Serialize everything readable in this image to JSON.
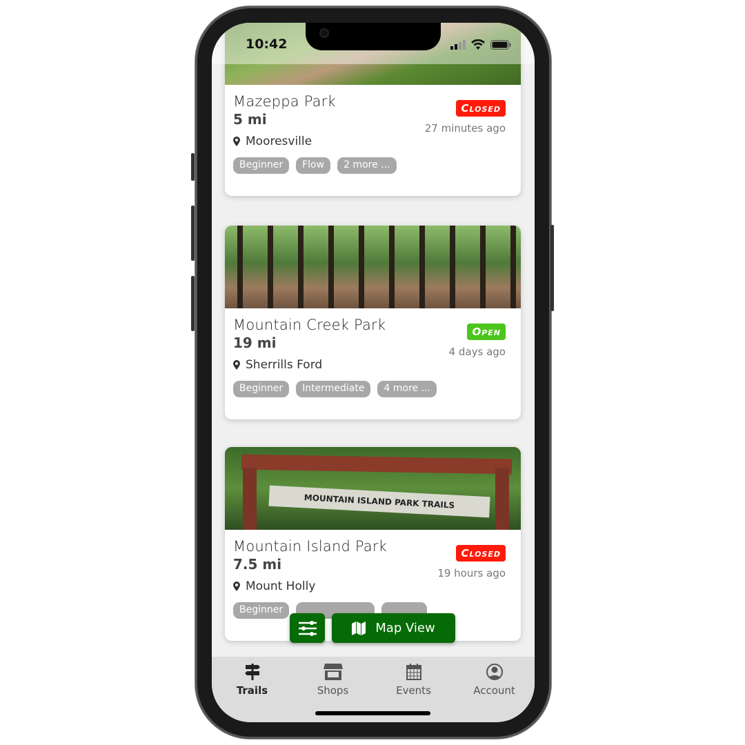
{
  "status_bar": {
    "time": "10:42"
  },
  "colors": {
    "closed": "#ff1a0a",
    "open": "#4cc51c",
    "primary": "#066b06",
    "tag": "#a8a8a8"
  },
  "trails": [
    {
      "name": "Mazeppa Park",
      "distance": "5 mi",
      "location": "Mooresville",
      "status": "Closed",
      "updated": "27 minutes ago",
      "tags": [
        "Beginner",
        "Flow",
        "2 more ..."
      ]
    },
    {
      "name": "Mountain Creek Park",
      "distance": "19 mi",
      "location": "Sherrills Ford",
      "status": "Open",
      "updated": "4 days ago",
      "tags": [
        "Beginner",
        "Intermediate",
        "4 more ..."
      ]
    },
    {
      "name": "Mountain Island Park",
      "distance": "7.5 mi",
      "location": "Mount Holly",
      "status": "Closed",
      "updated": "19 hours ago",
      "tags": [
        "Beginner"
      ],
      "image_sign": "MOUNTAIN ISLAND PARK TRAILS"
    }
  ],
  "actions": {
    "filter_icon": "sliders-icon",
    "map_view": "Map View"
  },
  "tabs": [
    {
      "label": "Trails",
      "icon": "signpost-icon"
    },
    {
      "label": "Shops",
      "icon": "store-icon"
    },
    {
      "label": "Events",
      "icon": "calendar-icon"
    },
    {
      "label": "Account",
      "icon": "user-circle-icon"
    }
  ]
}
